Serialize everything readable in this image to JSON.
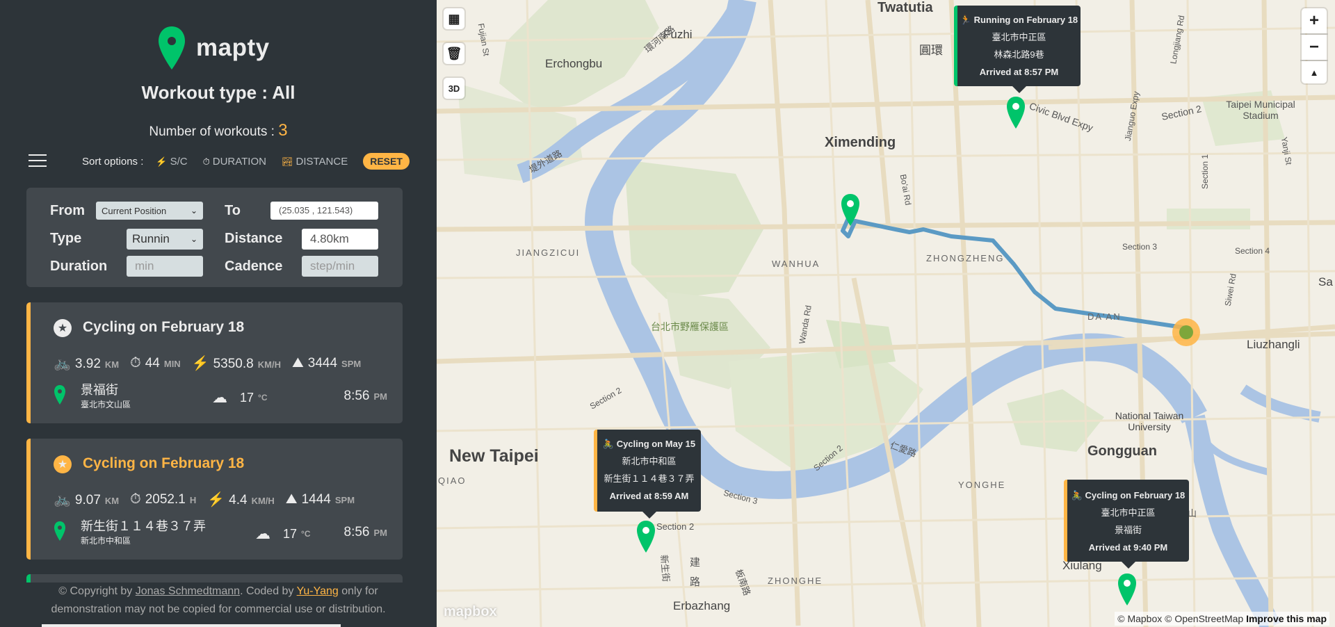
{
  "app": {
    "name": "mapty"
  },
  "header": {
    "workout_type": "Workout type : All",
    "count_label": "Number of workouts : ",
    "count": "3"
  },
  "sort": {
    "label": "Sort options :",
    "options": [
      {
        "icon": "⚡",
        "label": "S/C"
      },
      {
        "icon": "⏱",
        "label": "DURATION"
      },
      {
        "icon": "🏞",
        "label": "DISTANCE"
      }
    ],
    "reset_label": "RESET"
  },
  "form": {
    "from_label": "From",
    "from_value": "Current Position",
    "to_label": "To",
    "to_value": "(25.035 , 121.543)",
    "type_label": "Type",
    "type_value": "Runnin",
    "distance_label": "Distance",
    "distance_value": "4.80km",
    "duration_label": "Duration",
    "duration_placeholder": "min",
    "cadence_label": "Cadence",
    "cadence_placeholder": "step/min"
  },
  "workouts": [
    {
      "title": "Cycling on February 18",
      "title_color": "#ececec",
      "star_color": "#ececec",
      "distance": "3.92",
      "distance_unit": "KM",
      "duration": "44",
      "duration_unit": "MIN",
      "speed": "5350.8",
      "speed_unit": "KM/H",
      "elevation": "3444",
      "elevation_unit": "SPM",
      "location": "景福街",
      "district": "臺北市文山區",
      "temp": "17",
      "temp_unit": "°C",
      "time": "8:56",
      "time_unit": "PM"
    },
    {
      "title": "Cycling on February 18",
      "title_color": "#ffb545",
      "star_color": "#ffb545",
      "distance": "9.07",
      "distance_unit": "KM",
      "duration": "2052.1",
      "duration_unit": "H",
      "speed": "4.4",
      "speed_unit": "KM/H",
      "elevation": "1444",
      "elevation_unit": "SPM",
      "location": "新生街１１４巷３７弄",
      "district": "新北市中和區",
      "temp": "17",
      "temp_unit": "°C",
      "time": "8:56",
      "time_unit": "PM"
    }
  ],
  "footer": {
    "line1_prefix": "© Copyright by ",
    "author": "Jonas Schmedtmann",
    "coded_by": ". Coded by ",
    "coder": "Yu-Yang",
    "line1_suffix": " only for",
    "line2": "demonstration may not be copied for commercial use or distribution."
  },
  "map": {
    "controls": {
      "zoom_in": "+",
      "zoom_out": "−",
      "compass": "▲",
      "three_d": "3D"
    },
    "labels": {
      "twatutia": "Twatutia",
      "fuzhi": "Fuzhi",
      "erchongbu": "Erchongbu",
      "ximending": "Ximending",
      "jiangzicui": "JIANGZICUI",
      "wanhua": "WANHUA",
      "zhongzheng": "ZHONGZHENG",
      "daan": "DA'AN",
      "new_taipei": "New Taipei",
      "qiao": "QIAO",
      "yonghe": "YONGHE",
      "gongguan": "Gongguan",
      "xiulang": "Xiulang",
      "zhonghe": "ZHONGHE",
      "erbazhang": "Erbazhang",
      "liuzhangli": "Liuzhangli",
      "ntu": "National Taiwan University",
      "stadium": "Taipei Municipal Stadium",
      "civic": "Civic Blvd Expy",
      "section2_a": "Section 2",
      "section3": "Section 3",
      "section4": "Section 4",
      "section1": "Section 1",
      "section2_b": "Section 2",
      "section3_b": "Section 3",
      "section2_c": "Section 2",
      "section2_d": "Section 2",
      "wanda": "Wanda Rd",
      "boai": "Bo'ai Rd",
      "jianguo": "Jianguo Expy",
      "siwei": "Siwei Rd",
      "yanji": "Yanji St",
      "longjiang": "Longjiang Rd",
      "fujian": "Fujian St",
      "sa": "Sa",
      "park": "台北市野雁保護區",
      "huanhe": "環河南路",
      "yuanhuan": "圓環",
      "dike": "堤外道路",
      "xinsheng": "新生街",
      "jian": "建",
      "lu": "路",
      "banqiao": "板南路",
      "renai": "仁愛路",
      "shan": "山"
    },
    "popups": [
      {
        "title": "Running on February 18",
        "line1": "臺北市中正區",
        "line2": "林森北路9巷",
        "line3": "Arrived at 8:57 PM",
        "icon": "🏃"
      },
      {
        "title": "Cycling on May 15",
        "line1": "新北市中和區",
        "line2": "新生街１１４巷３７弄",
        "line3": "Arrived at 8:59 AM",
        "icon": "🚴"
      },
      {
        "title": "Cycling on February 18",
        "line1": "臺北市中正區",
        "line2": "景福街",
        "line3": "Arrived at 9:40 PM",
        "icon": "🚴"
      }
    ],
    "attribution": "© Mapbox © OpenStreetMap",
    "improve": "Improve this map",
    "mapbox_logo": "mapbox",
    "accent_green": "#00c46a",
    "accent_orange": "#ffb545",
    "route_color": "#5b9ac4"
  }
}
